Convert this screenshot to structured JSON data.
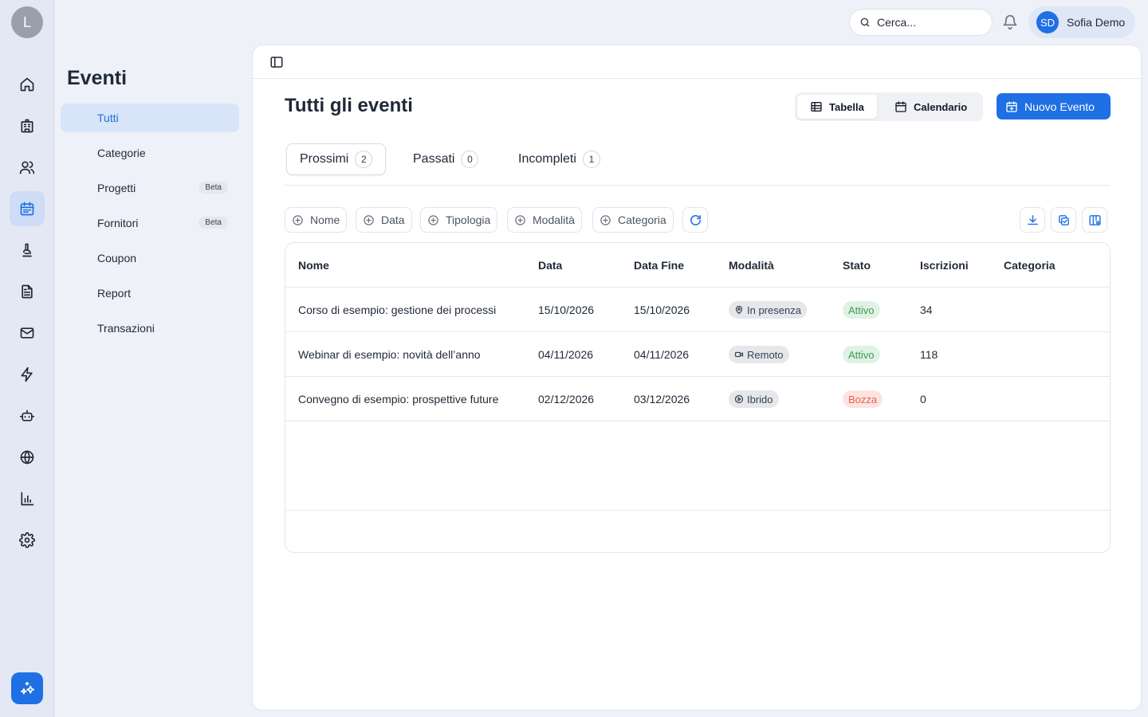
{
  "rail": {
    "avatar_initial": "L",
    "items": [
      {
        "icon": "home-icon"
      },
      {
        "icon": "building-icon"
      },
      {
        "icon": "users-icon"
      },
      {
        "icon": "calendar-icon",
        "active": true
      },
      {
        "icon": "microscope-icon"
      },
      {
        "icon": "document-icon"
      },
      {
        "icon": "mail-icon"
      },
      {
        "icon": "bolt-icon"
      },
      {
        "icon": "bot-icon"
      },
      {
        "icon": "globe-icon"
      },
      {
        "icon": "bar-chart-icon"
      },
      {
        "icon": "gear-icon"
      }
    ],
    "ai_icon": "sparkles-icon"
  },
  "sidebar": {
    "title": "Eventi",
    "items": [
      {
        "label": "Tutti",
        "active": true
      },
      {
        "label": "Categorie"
      },
      {
        "label": "Progetti",
        "badge": "Beta"
      },
      {
        "label": "Fornitori",
        "badge": "Beta"
      },
      {
        "label": "Coupon"
      },
      {
        "label": "Report"
      },
      {
        "label": "Transazioni"
      }
    ]
  },
  "topbar": {
    "search_placeholder": "Cerca...",
    "user_initials": "SD",
    "user_name": "Sofia Demo"
  },
  "main": {
    "title": "Tutti gli eventi",
    "view_table": "Tabella",
    "view_calendar": "Calendario",
    "new_button": "Nuovo Evento",
    "tabs": [
      {
        "label": "Prossimi",
        "count": "2"
      },
      {
        "label": "Passati",
        "count": "0"
      },
      {
        "label": "Incompleti",
        "count": "1"
      }
    ],
    "filters": [
      "Nome",
      "Data",
      "Tipologia",
      "Modalità",
      "Categoria"
    ],
    "columns": [
      "Nome",
      "Data",
      "Data Fine",
      "Modalità",
      "Stato",
      "Iscrizioni",
      "Categoria"
    ],
    "rows": [
      {
        "name": "Corso di esempio: gestione dei processi",
        "date": "15/10/2026",
        "end": "15/10/2026",
        "mode": "In presenza",
        "mode_icon": "map-pin-icon",
        "status": "Attivo",
        "status_kind": "ok",
        "signups": "34",
        "category": ""
      },
      {
        "name": "Webinar di esempio: novità dell’anno",
        "date": "04/11/2026",
        "end": "04/11/2026",
        "mode": "Remoto",
        "mode_icon": "video-icon",
        "status": "Attivo",
        "status_kind": "ok",
        "signups": "118",
        "category": ""
      },
      {
        "name": "Convegno di esempio: prospettive future",
        "date": "02/12/2026",
        "end": "03/12/2026",
        "mode": "Ibrido",
        "mode_icon": "play-circle-icon",
        "status": "Bozza",
        "status_kind": "draft",
        "signups": "0",
        "category": ""
      }
    ]
  },
  "colors": {
    "accent": "#1f6fe5",
    "active_bg": "#d8e4f8",
    "ok": "#3f9a5c",
    "draft": "#e0664f"
  }
}
